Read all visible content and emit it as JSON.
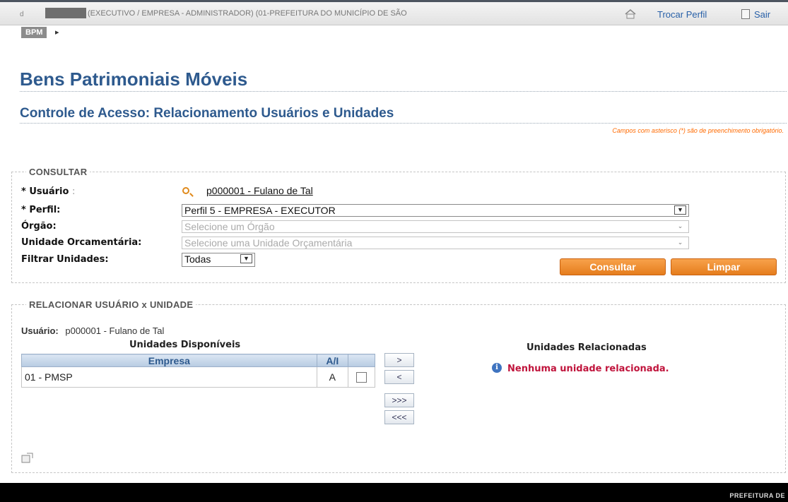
{
  "topbar": {
    "lead": "d",
    "user_info": "(EXECUTIVO / EMPRESA - ADMINISTRADOR) (01-PREFEITURA DO MUNICÍPIO DE SÃO",
    "trocar_perfil": "Trocar Perfil",
    "sair": "Sair"
  },
  "breadcrumb": {
    "module": "BPM",
    "arrow": "▸"
  },
  "page_title": "Bens Patrimoniais Móveis",
  "section_title": "Controle de Acesso: Relacionamento Usuários e Unidades",
  "required_note": "Campos com asterisco (*) são de preenchimento obrigatório.",
  "consultar": {
    "legend": "CONSULTAR",
    "usuario_label": "Usuário",
    "usuario_value": "p000001 - Fulano de Tal",
    "perfil_label": "Perfil:",
    "perfil_value": "Perfil 5 - EMPRESA - EXECUTOR",
    "orgao_label": "Órgão:",
    "orgao_placeholder": "Selecione um Órgão",
    "unidade_label": "Unidade Orcamentária:",
    "unidade_placeholder": "Selecione uma Unidade Orçamentária",
    "filtrar_label": "Filtrar Unidades:",
    "filtrar_value": "Todas",
    "btn_consultar": "Consultar",
    "btn_limpar": "Limpar"
  },
  "relacionar": {
    "legend": "RELACIONAR USUÁRIO x UNIDADE",
    "usuario_label": "Usuário:",
    "usuario_value": "p000001 - Fulano de Tal",
    "disponiveis_title": "Unidades Disponíveis",
    "relacionadas_title": "Unidades Relacionadas",
    "columns": [
      "Empresa",
      "A/I"
    ],
    "rows": [
      {
        "empresa": "01 - PMSP",
        "ai": "A"
      }
    ],
    "move_buttons": [
      ">",
      "<",
      ">>>",
      "<<<"
    ],
    "empty_message": "Nenhuma unidade relacionada."
  },
  "footer": {
    "brand": "PREFEITURA DE"
  }
}
